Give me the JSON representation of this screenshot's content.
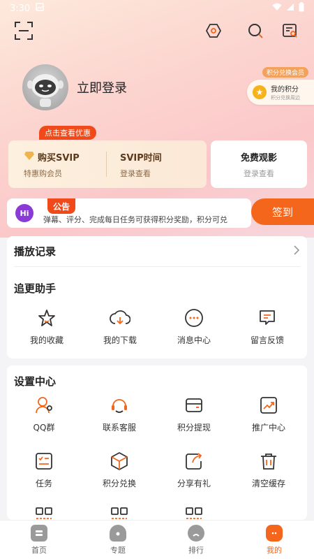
{
  "status": {
    "time": "3:30"
  },
  "profile": {
    "login_label": "立即登录"
  },
  "points": {
    "tag": "积分兑换会员",
    "title": "我的积分",
    "subtitle": "积分兑换周边"
  },
  "promo": {
    "badge": "点击查看优惠"
  },
  "vip": {
    "buy_title": "购买SVIP",
    "buy_sub": "特惠购会员",
    "time_title": "SVIP时间",
    "time_sub": "登录查看"
  },
  "free": {
    "title": "免费观影",
    "sub": "登录查看"
  },
  "notice": {
    "icon": "Hi",
    "tag": "公告",
    "text": "弹幕、评分、完成每日任务可获得积分奖励，积分可兑",
    "checkin": "签到"
  },
  "history": {
    "title": "播放记录"
  },
  "follow": {
    "title": "追更助手",
    "items": [
      {
        "label": "我的收藏",
        "icon": "star-icon"
      },
      {
        "label": "我的下载",
        "icon": "cloud-download-icon"
      },
      {
        "label": "消息中心",
        "icon": "message-icon"
      },
      {
        "label": "留言反馈",
        "icon": "feedback-icon"
      }
    ]
  },
  "settings": {
    "title": "设置中心",
    "items": [
      {
        "label": "QQ群",
        "icon": "user-group-icon"
      },
      {
        "label": "联系客服",
        "icon": "headset-icon"
      },
      {
        "label": "积分提现",
        "icon": "wallet-icon"
      },
      {
        "label": "推广中心",
        "icon": "trend-icon"
      },
      {
        "label": "任务",
        "icon": "task-icon"
      },
      {
        "label": "积分兑换",
        "icon": "box-icon"
      },
      {
        "label": "分享有礼",
        "icon": "share-icon"
      },
      {
        "label": "清空缓存",
        "icon": "trash-icon"
      }
    ]
  },
  "tabs": [
    {
      "label": "首页"
    },
    {
      "label": "专题"
    },
    {
      "label": "排行"
    },
    {
      "label": "我的"
    }
  ],
  "colors": {
    "accent": "#f4661c",
    "badge": "#f04a1a",
    "vip_text": "#5b3a1b"
  }
}
